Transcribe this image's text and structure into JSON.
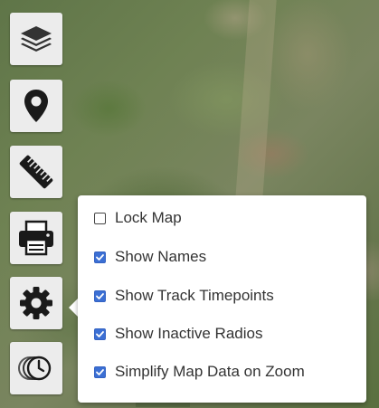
{
  "map": {
    "background": "satellite-imagery"
  },
  "toolbar": {
    "buttons": [
      {
        "icon": "layers-icon",
        "label": "Layers"
      },
      {
        "icon": "map-pin-icon",
        "label": "Location"
      },
      {
        "icon": "ruler-icon",
        "label": "Measure"
      },
      {
        "icon": "printer-icon",
        "label": "Print"
      },
      {
        "icon": "gear-icon",
        "label": "Settings",
        "active": true
      },
      {
        "icon": "history-clock-icon",
        "label": "History"
      }
    ]
  },
  "settings_popup": {
    "options": [
      {
        "label": "Lock Map",
        "checked": false
      },
      {
        "label": "Show Names",
        "checked": true
      },
      {
        "label": "Show Track Timepoints",
        "checked": true
      },
      {
        "label": "Show Inactive Radios",
        "checked": true
      },
      {
        "label": "Simplify Map Data on Zoom",
        "checked": true
      }
    ]
  },
  "colors": {
    "checkbox_checked": "#3b6fd4",
    "button_bg": "#ececec",
    "icon_dark": "#222222"
  }
}
